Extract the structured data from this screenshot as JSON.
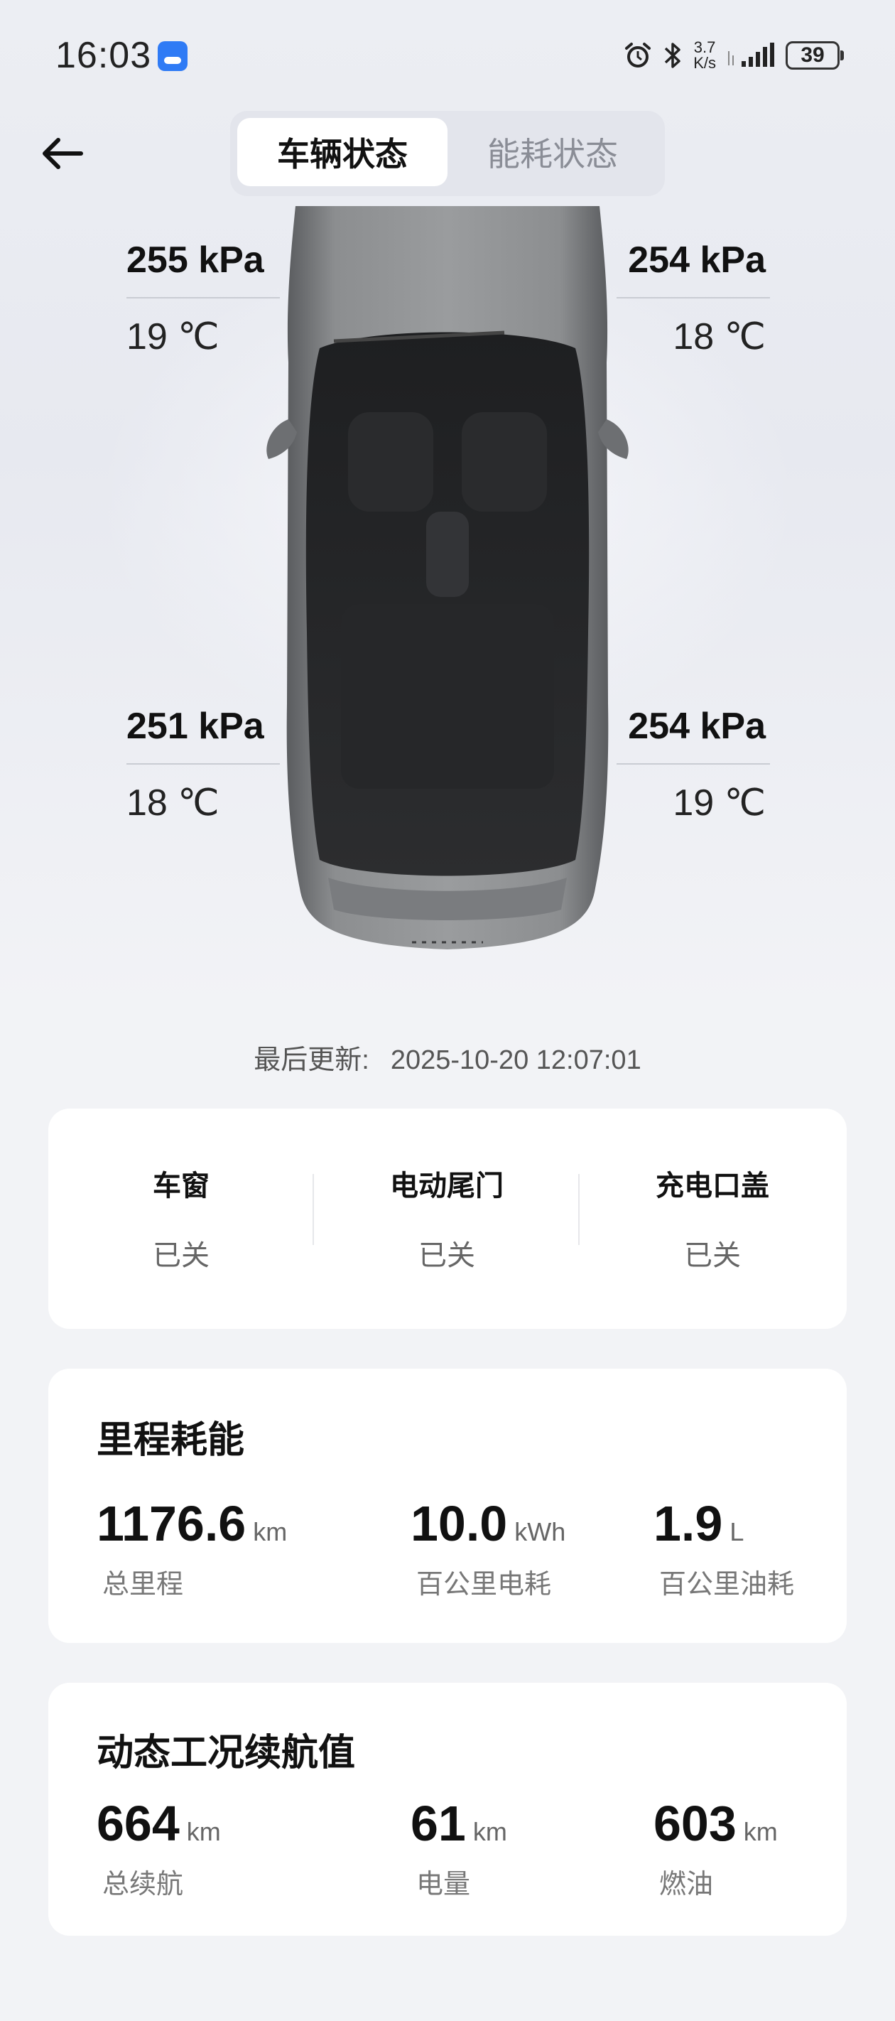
{
  "status_bar": {
    "time": "16:03",
    "net_speed_value": "3.7",
    "net_speed_unit": "K/s",
    "battery": "39",
    "icons": [
      "app-badge-icon",
      "alarm-icon",
      "bluetooth-icon",
      "signal-icon",
      "battery-icon"
    ]
  },
  "nav": {
    "tabs": [
      {
        "label": "车辆状态",
        "active": true
      },
      {
        "label": "能耗状态",
        "active": false
      }
    ]
  },
  "tires": {
    "front_left": {
      "pressure": "255 kPa",
      "temp": "19 ℃"
    },
    "front_right": {
      "pressure": "254 kPa",
      "temp": "18 ℃"
    },
    "rear_left": {
      "pressure": "251 kPa",
      "temp": "18 ℃"
    },
    "rear_right": {
      "pressure": "254 kPa",
      "temp": "19 ℃"
    }
  },
  "last_update": {
    "label": "最后更新:",
    "value": "2025-10-20 12:07:01"
  },
  "doors": [
    {
      "name": "车窗",
      "state": "已关"
    },
    {
      "name": "电动尾门",
      "state": "已关"
    },
    {
      "name": "充电口盖",
      "state": "已关"
    }
  ],
  "mileage": {
    "title": "里程耗能",
    "metrics": [
      {
        "value": "1176.6",
        "unit": "km",
        "label": "总里程"
      },
      {
        "value": "10.0",
        "unit": "kWh",
        "label": "百公里电耗"
      },
      {
        "value": "1.9",
        "unit": "L",
        "label": "百公里油耗"
      }
    ]
  },
  "range": {
    "title": "动态工况续航值",
    "metrics": [
      {
        "value": "664",
        "unit": "km",
        "label": "总续航"
      },
      {
        "value": "61",
        "unit": "km",
        "label": "电量"
      },
      {
        "value": "603",
        "unit": "km",
        "label": "燃油"
      }
    ]
  }
}
